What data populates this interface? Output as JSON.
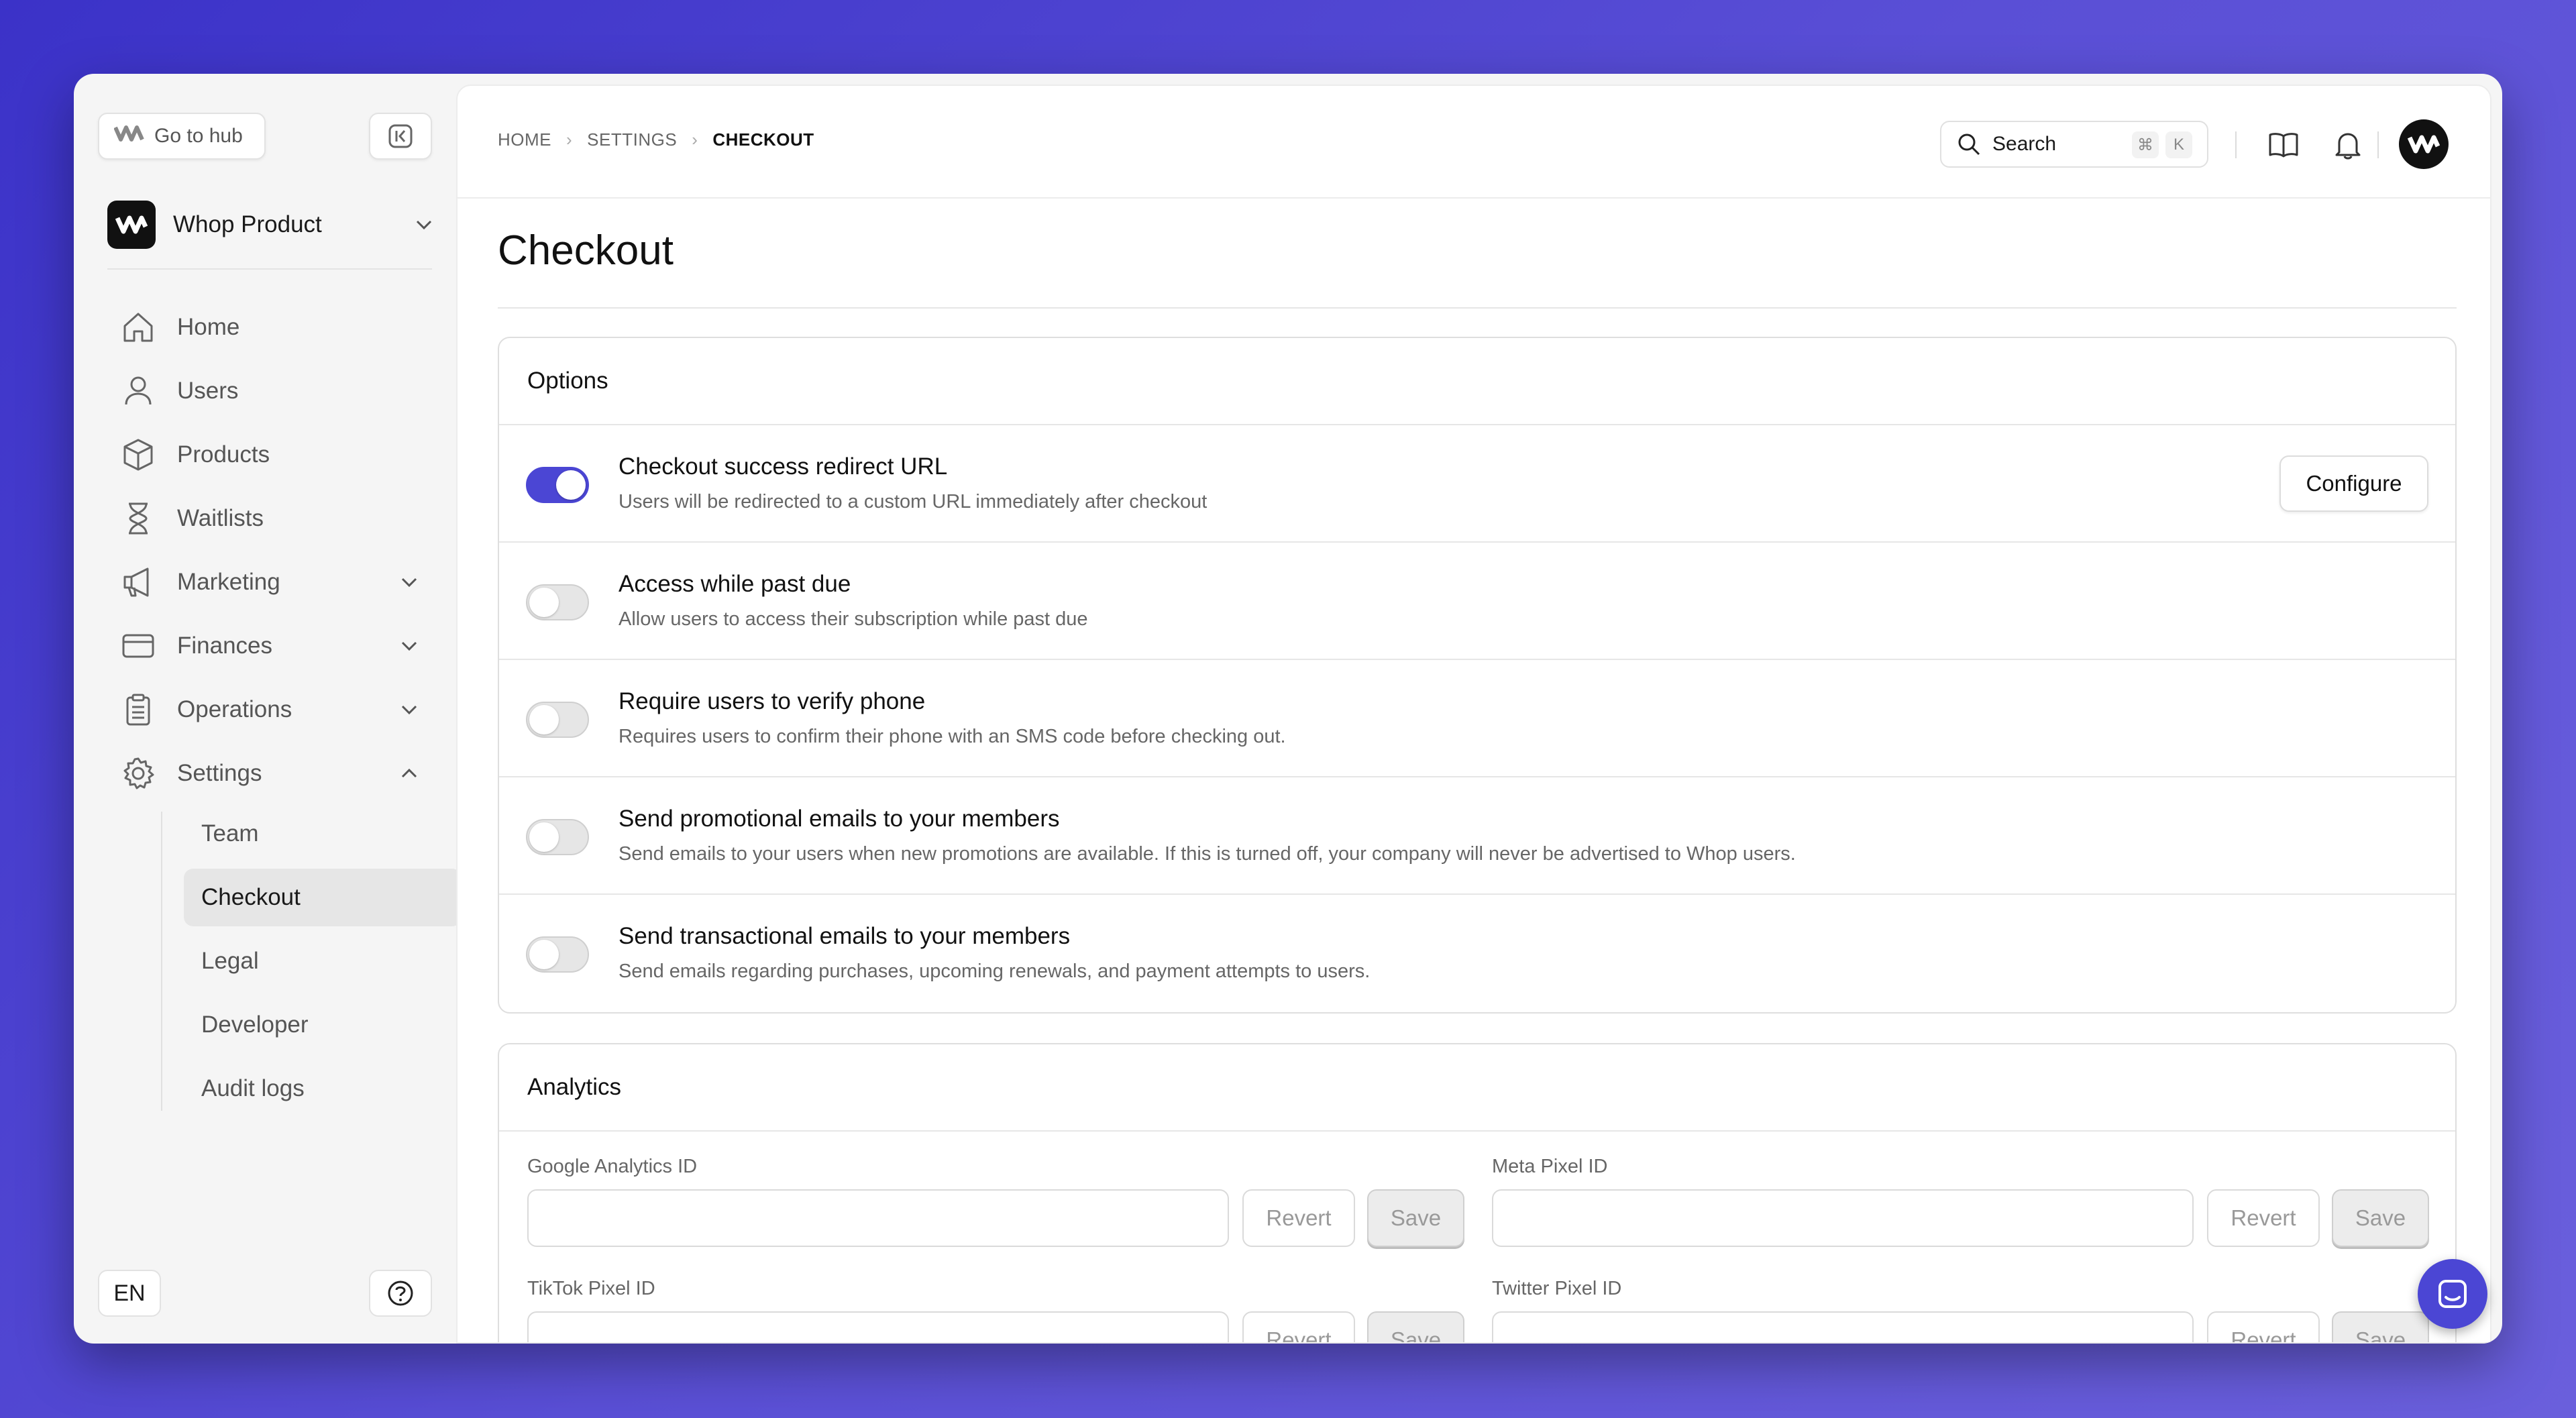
{
  "sidebar": {
    "hub_label": "Go to hub",
    "product_name": "Whop Product",
    "items": [
      {
        "label": "Home",
        "icon": "home-icon"
      },
      {
        "label": "Users",
        "icon": "user-icon"
      },
      {
        "label": "Products",
        "icon": "box-icon"
      },
      {
        "label": "Waitlists",
        "icon": "hourglass-icon"
      },
      {
        "label": "Marketing",
        "icon": "megaphone-icon"
      },
      {
        "label": "Finances",
        "icon": "credit-card-icon"
      },
      {
        "label": "Operations",
        "icon": "clipboard-icon"
      },
      {
        "label": "Settings",
        "icon": "gear-icon"
      }
    ],
    "settings_sub": [
      "Team",
      "Checkout",
      "Legal",
      "Developer",
      "Audit logs"
    ],
    "active_sub": "Checkout",
    "lang": "EN"
  },
  "topbar": {
    "breadcrumb": [
      "HOME",
      "SETTINGS",
      "CHECKOUT"
    ],
    "search_label": "Search",
    "shortcut": [
      "⌘",
      "K"
    ]
  },
  "page": {
    "title": "Checkout"
  },
  "options": {
    "heading": "Options",
    "configure_label": "Configure",
    "rows": [
      {
        "title": "Checkout success redirect URL",
        "desc": "Users will be redirected to a custom URL immediately after checkout",
        "enabled": true
      },
      {
        "title": "Access while past due",
        "desc": "Allow users to access their subscription while past due",
        "enabled": false
      },
      {
        "title": "Require users to verify phone",
        "desc": "Requires users to confirm their phone with an SMS code before checking out.",
        "enabled": false
      },
      {
        "title": "Send promotional emails to your members",
        "desc": "Send emails to your users when new promotions are available. If this is turned off, your company will never be advertised to Whop users.",
        "enabled": false
      },
      {
        "title": "Send transactional emails to your members",
        "desc": "Send emails regarding purchases, upcoming renewals, and payment attempts to users.",
        "enabled": false
      }
    ]
  },
  "analytics": {
    "heading": "Analytics",
    "revert_label": "Revert",
    "save_label": "Save",
    "fields": [
      {
        "label": "Google Analytics ID",
        "value": ""
      },
      {
        "label": "Meta Pixel ID",
        "value": ""
      },
      {
        "label": "TikTok Pixel ID",
        "value": ""
      },
      {
        "label": "Twitter Pixel ID",
        "value": ""
      }
    ]
  },
  "colors": {
    "accent": "#4b46d4",
    "background": "#5a4fd6"
  }
}
